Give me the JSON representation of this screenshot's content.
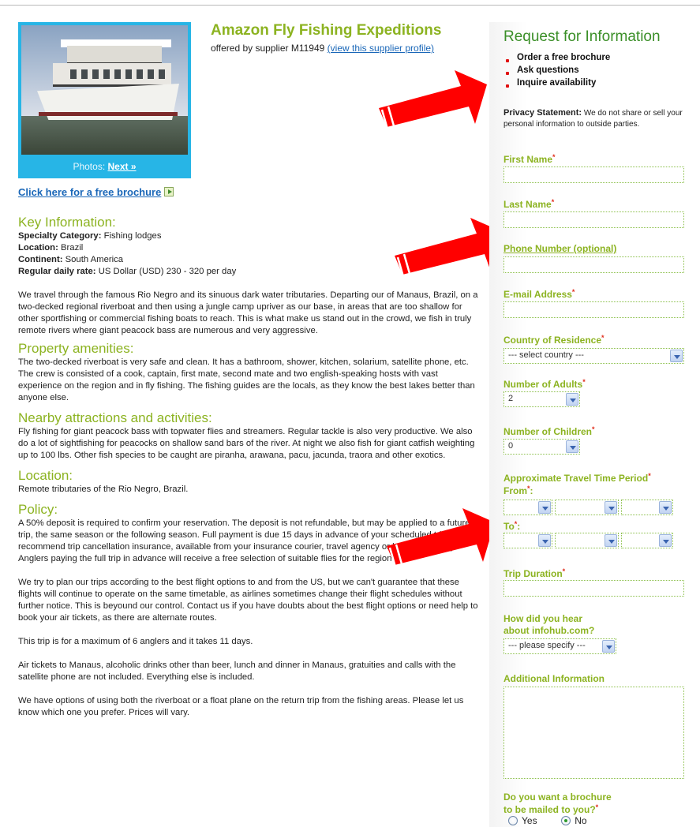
{
  "listing": {
    "title": "Amazon Fly Fishing Expeditions",
    "offered_by": "offered by supplier M11949",
    "supplier_link": "(view this supplier profile)",
    "photos_label": "Photos:",
    "photos_next": "Next »",
    "brochure_link": "Click here for a free brochure"
  },
  "key_info": {
    "heading": "Key Information:",
    "specialty_label": "Specialty Category:",
    "specialty_value": "Fishing lodges",
    "location_label": "Location:",
    "location_value": "Brazil",
    "continent_label": "Continent:",
    "continent_value": "South America",
    "rate_label": "Regular daily rate:",
    "rate_value": "US Dollar (USD) 230 - 320 per day",
    "description": "We travel through the famous Rio Negro and its sinuous dark water tributaries. Departing our of Manaus, Brazil, on a two-decked regional riverboat and then using a jungle camp upriver as our base, in areas that are too shallow for other sportfishing or commercial fishing boats to reach. This is what make us stand out in the crowd, we fish in truly remote rivers where giant peacock bass are numerous and very aggressive."
  },
  "amenities": {
    "heading": "Property amenities:",
    "text": "The two-decked riverboat is very safe and clean. It has a bathroom, shower, kitchen, solarium, satellite phone, etc. The crew is consisted of a cook, captain, first mate, second mate and two english-speaking hosts with vast experience on the region and in fly fishing. The fishing guides are the locals, as they know the best lakes better than anyone else."
  },
  "attractions": {
    "heading": "Nearby attractions and activities:",
    "text": "Fly fishing for giant peacock bass with topwater flies and streamers. Regular tackle is also very productive. We also do a lot of sightfishing for peacocks on shallow sand bars of the river. At night we also fish for giant catfish weighting up to 100 lbs. Other fish species to be caught are piranha, arawana, pacu, jacunda, traora and other exotics."
  },
  "location": {
    "heading": "Location:",
    "text": "Remote tributaries of the Rio Negro, Brazil."
  },
  "policy": {
    "heading": "Policy:",
    "p1": "A 50% deposit is required to confirm your reservation. The deposit is not refundable, but may be applied to a future trip, the same season or the following season. Full payment is due 15 days in advance of your scheduled trip. We recommend trip cancellation insurance, available from your insurance courier, travel agency or booking agency. Anglers paying the full trip in advance will receive a free selection of suitable flies for the region.",
    "p2": "We try to plan our trips according to the best flight options to and from the US, but we can't guarantee that these flights will continue to operate on the same timetable, as airlines sometimes change their flight schedules without further notice. This is beyound our control. Contact us if you have doubts about the best flight options or need help to book your air tickets, as there are alternate routes.",
    "p3": "This trip is for a maximum of 6 anglers and it takes 11 days.",
    "p4": "Air tickets to Manaus, alcoholic drinks other than beer, lunch and dinner in Manaus, gratuities and calls with the satellite phone are not included. Everything else is included.",
    "p5": "We have options of using both the riverboat or a float plane on the return trip from the fishing areas. Please let us know which one you prefer. Prices will vary."
  },
  "form": {
    "title": "Request for Information",
    "bullets": [
      "Order a free brochure",
      "Ask questions",
      "Inquire availability"
    ],
    "privacy_label": "Privacy Statement:",
    "privacy_text": "We do not share or sell your personal information to outside parties.",
    "first_name": "First Name",
    "last_name": "Last Name",
    "phone": "Phone Number (optional)",
    "email": "E-mail Address",
    "country": "Country of Residence",
    "country_value": "--- select country ---",
    "adults": "Number of Adults",
    "adults_value": "2",
    "children": "Number of Children",
    "children_value": "0",
    "travel_period": "Approximate Travel Time Period",
    "from": "From",
    "to": "To",
    "duration": "Trip Duration",
    "hear_line1": "How did you hear",
    "hear_line2": "about infohub.com?",
    "hear_value": "--- please specify ---",
    "additional": "Additional Information",
    "brochure_q1": "Do you want a brochure",
    "brochure_q2": "to be mailed to you?",
    "yes": "Yes",
    "no": "No",
    "required_mark": "*"
  },
  "colors": {
    "accent_green": "#8cb321",
    "title_green": "#3b8f28",
    "link_blue": "#1a67b8",
    "photo_frame": "#27b5e6",
    "arrow_red": "#ff0000"
  }
}
